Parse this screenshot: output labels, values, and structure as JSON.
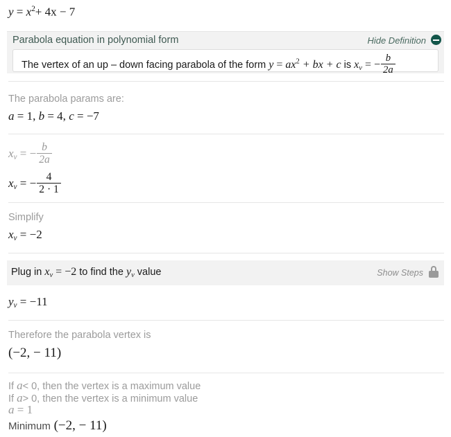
{
  "problem": {
    "equation_lhs": "y",
    "equation_rhs_a": "x",
    "equation_exp": "2",
    "equation_rest": "+ 4x − 7"
  },
  "definition": {
    "title": "Parabola equation in polynomial form",
    "toggle_label": "Hide Definition",
    "toggle_icon": "minus-circle-icon",
    "text_before": "The vertex of an up – down facing parabola of the form",
    "formula_lhs": "y",
    "formula_eq": "=",
    "formula_a": "ax",
    "formula_exp": "2",
    "formula_mid": "+ bx + c",
    "text_is": "is",
    "formula_xv": "x",
    "formula_xv_sub": "v",
    "formula_xv_eq": "=",
    "formula_minus": "−",
    "formula_frac_top": "b",
    "formula_frac_bot": "2a"
  },
  "steps": {
    "params_label": "The parabola params are:",
    "params_a": "a",
    "params_a_val": "= 1,",
    "params_b": "b",
    "params_b_val": "= 4,",
    "params_c": "c",
    "params_c_val": "= −7",
    "xv_formula_lhs": "x",
    "xv_formula_sub": "v",
    "xv_formula_eq": "=",
    "xv_formula_minus": "−",
    "xv_formula_top": "b",
    "xv_formula_bot": "2a",
    "xv_sub_lhs": "x",
    "xv_sub_sub": "v",
    "xv_sub_eq": "=",
    "xv_sub_minus": "−",
    "xv_sub_top": "4",
    "xv_sub_bot": "2 · 1",
    "simplify_label": "Simplify",
    "xv_result_lhs": "x",
    "xv_result_sub": "v",
    "xv_result_val": "= −2",
    "plug_prefix": "Plug in",
    "plug_xv": "x",
    "plug_xv_sub": "v",
    "plug_xv_eq": "= −2",
    "plug_mid": "to find the",
    "plug_yv": "y",
    "plug_yv_sub": "v",
    "plug_suffix": "value",
    "show_steps_label": "Show Steps",
    "show_steps_icon": "lock-icon",
    "yv_lhs": "y",
    "yv_sub": "v",
    "yv_val": "= −11",
    "therefore_label": "Therefore the parabola vertex is",
    "vertex_open": "(",
    "vertex_x": "−2,",
    "vertex_y": "− 11",
    "vertex_close": ")",
    "cond_max_if": "If",
    "cond_max_a": "a",
    "cond_max_rest": "< 0, then the vertex is a maximum value",
    "cond_min_if": "If",
    "cond_min_a": "a",
    "cond_min_rest": "> 0, then the vertex is a minimum value",
    "cond_a_sym": "a",
    "cond_a_val": "= 1",
    "answer_label": "Minimum",
    "answer_open": "(",
    "answer_x": "−2,",
    "answer_y": "− 11",
    "answer_close": ")"
  },
  "colors": {
    "accent": "#13564a",
    "band": "#f2f2f2",
    "hint": "#9b9b9b",
    "rule": "#e6e6e6"
  }
}
